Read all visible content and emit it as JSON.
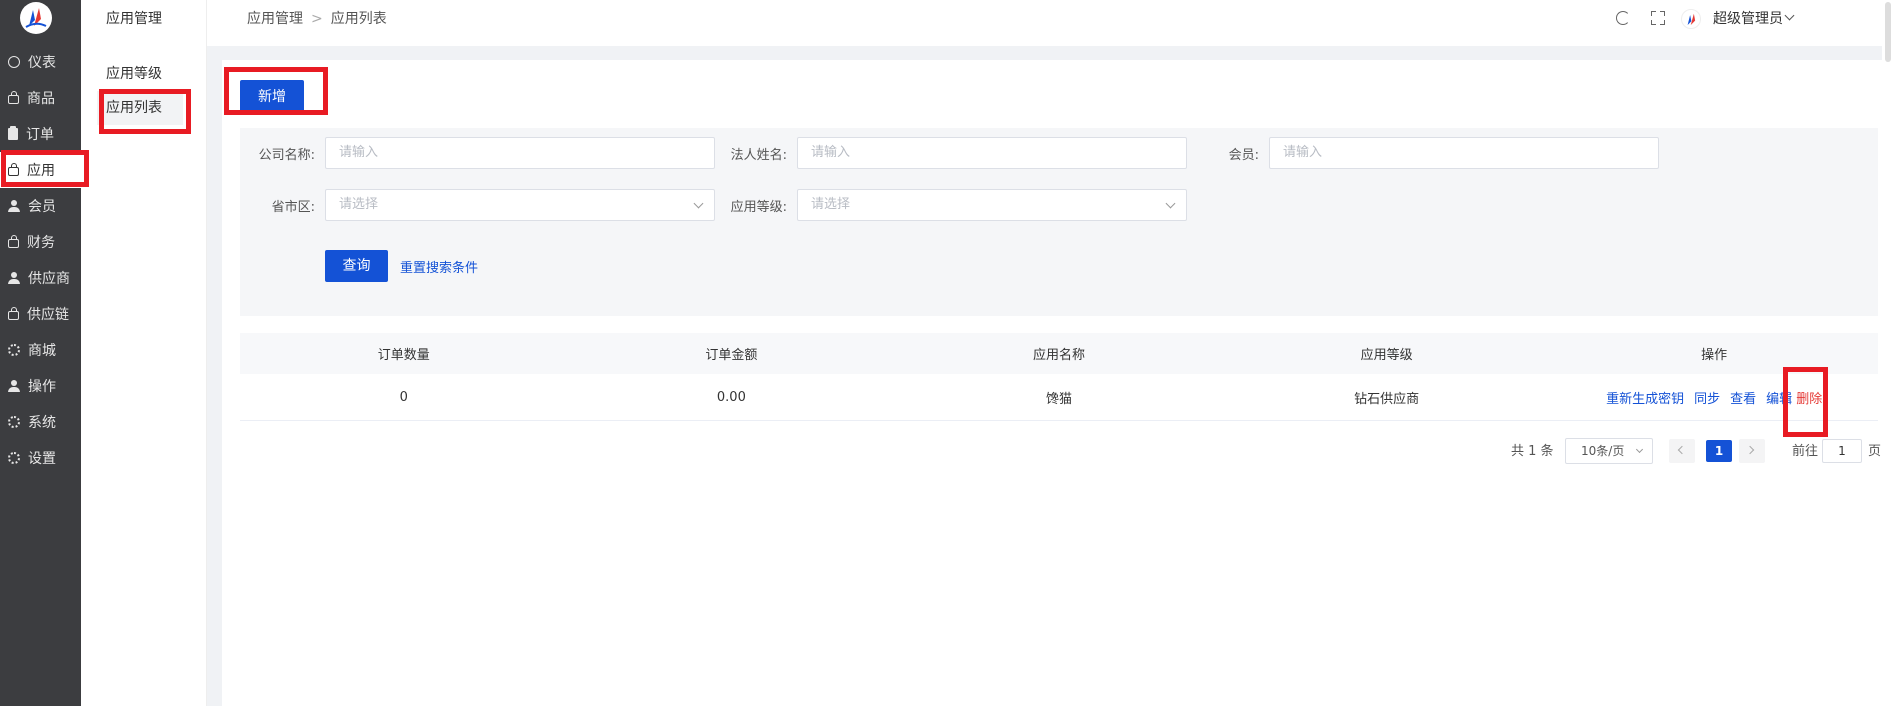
{
  "sidebar": {
    "items": [
      {
        "label": "仪表",
        "icon": "gauge-icon"
      },
      {
        "label": "商品",
        "icon": "bag-icon"
      },
      {
        "label": "订单",
        "icon": "clipboard-icon"
      },
      {
        "label": "应用",
        "icon": "bag-icon"
      },
      {
        "label": "会员",
        "icon": "user-icon"
      },
      {
        "label": "财务",
        "icon": "bag-icon"
      },
      {
        "label": "供应商",
        "icon": "user-icon"
      },
      {
        "label": "供应链",
        "icon": "bag-icon"
      },
      {
        "label": "商城",
        "icon": "gear-icon"
      },
      {
        "label": "操作",
        "icon": "user-icon"
      },
      {
        "label": "系统",
        "icon": "gear-icon"
      },
      {
        "label": "设置",
        "icon": "gear-icon"
      }
    ]
  },
  "submenu": {
    "title": "应用管理",
    "items": [
      {
        "label": "应用等级"
      },
      {
        "label": "应用列表"
      }
    ]
  },
  "header": {
    "breadcrumb": [
      "应用管理",
      "应用列表"
    ],
    "user_name": "超级管理员"
  },
  "toolbar": {
    "add_label": "新增"
  },
  "search": {
    "company_label": "公司名称:",
    "company_placeholder": "请输入",
    "legal_label": "法人姓名:",
    "legal_placeholder": "请输入",
    "member_label": "会员:",
    "member_placeholder": "请输入",
    "region_label": "省市区:",
    "region_placeholder": "请选择",
    "level_label": "应用等级:",
    "level_placeholder": "请选择",
    "query_label": "查询",
    "reset_label": "重置搜索条件"
  },
  "table": {
    "columns": [
      "订单数量",
      "订单金额",
      "应用名称",
      "应用等级",
      "操作"
    ],
    "rows": [
      {
        "order_count": "0",
        "order_amount": "0.00",
        "app_name": "馋猫",
        "app_level": "钻石供应商"
      }
    ],
    "ops": {
      "regen": "重新生成密钥",
      "sync": "同步",
      "view": "查看",
      "edit": "编辑",
      "delete": "删除"
    }
  },
  "pagination": {
    "total": "共 1 条",
    "page_size": "10条/页",
    "current": "1",
    "goto_prefix": "前往",
    "goto_value": "1",
    "goto_suffix": "页"
  },
  "colors": {
    "primary": "#1452d6",
    "danger": "#e53935",
    "sidebar": "#3c3d40",
    "annotation": "#e81b23"
  }
}
